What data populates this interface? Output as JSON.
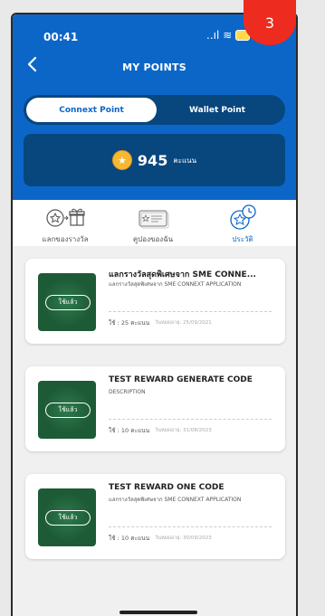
{
  "status_bar": {
    "time": "00:41",
    "signal": "..ıl",
    "wifi": "≋"
  },
  "header": {
    "title": "MY POINTS"
  },
  "tabs": [
    {
      "label": "Connext Point",
      "active": true
    },
    {
      "label": "Wallet Point",
      "active": false
    }
  ],
  "points": {
    "value": "945",
    "unit": "คะแนน"
  },
  "menu": [
    {
      "label": "แลกของรางวัล",
      "icon": "redeem-gift-icon",
      "active": false
    },
    {
      "label": "คูปองของฉัน",
      "icon": "coupon-icon",
      "active": false
    },
    {
      "label": "ประวัติ",
      "icon": "history-icon",
      "active": true
    }
  ],
  "rewards": [
    {
      "title": "แลกรางวัลสุดพิเศษจาก SME CONNE...",
      "description": "แลกรางวัลสุดพิเศษจาก SME CONNEXT APPLICATION",
      "status": "ใช้แล้ว",
      "points": "ใช้ : 25 คะแนน",
      "expiry": "วันหมดอายุ: 25/09/2021"
    },
    {
      "title": "TEST REWARD GENERATE CODE",
      "description": "DESCRIPTION",
      "status": "ใช้แล้ว",
      "points": "ใช้ : 10 คะแนน",
      "expiry": "วันหมดอายุ: 31/08/2023"
    },
    {
      "title": "TEST REWARD ONE CODE",
      "description": "แลกรางวัลสุดพิเศษจาก SME CONNEXT APPLICATION",
      "status": "ใช้แล้ว",
      "points": "ใช้ : 10 คะแนน",
      "expiry": "วันหมดอายุ: 30/09/2023"
    }
  ],
  "badge": {
    "number": "3"
  },
  "colors": {
    "primary": "#0b66c8",
    "dark_panel": "#08467e",
    "badge": "#ee2b1f",
    "coin": "#f7b733"
  }
}
